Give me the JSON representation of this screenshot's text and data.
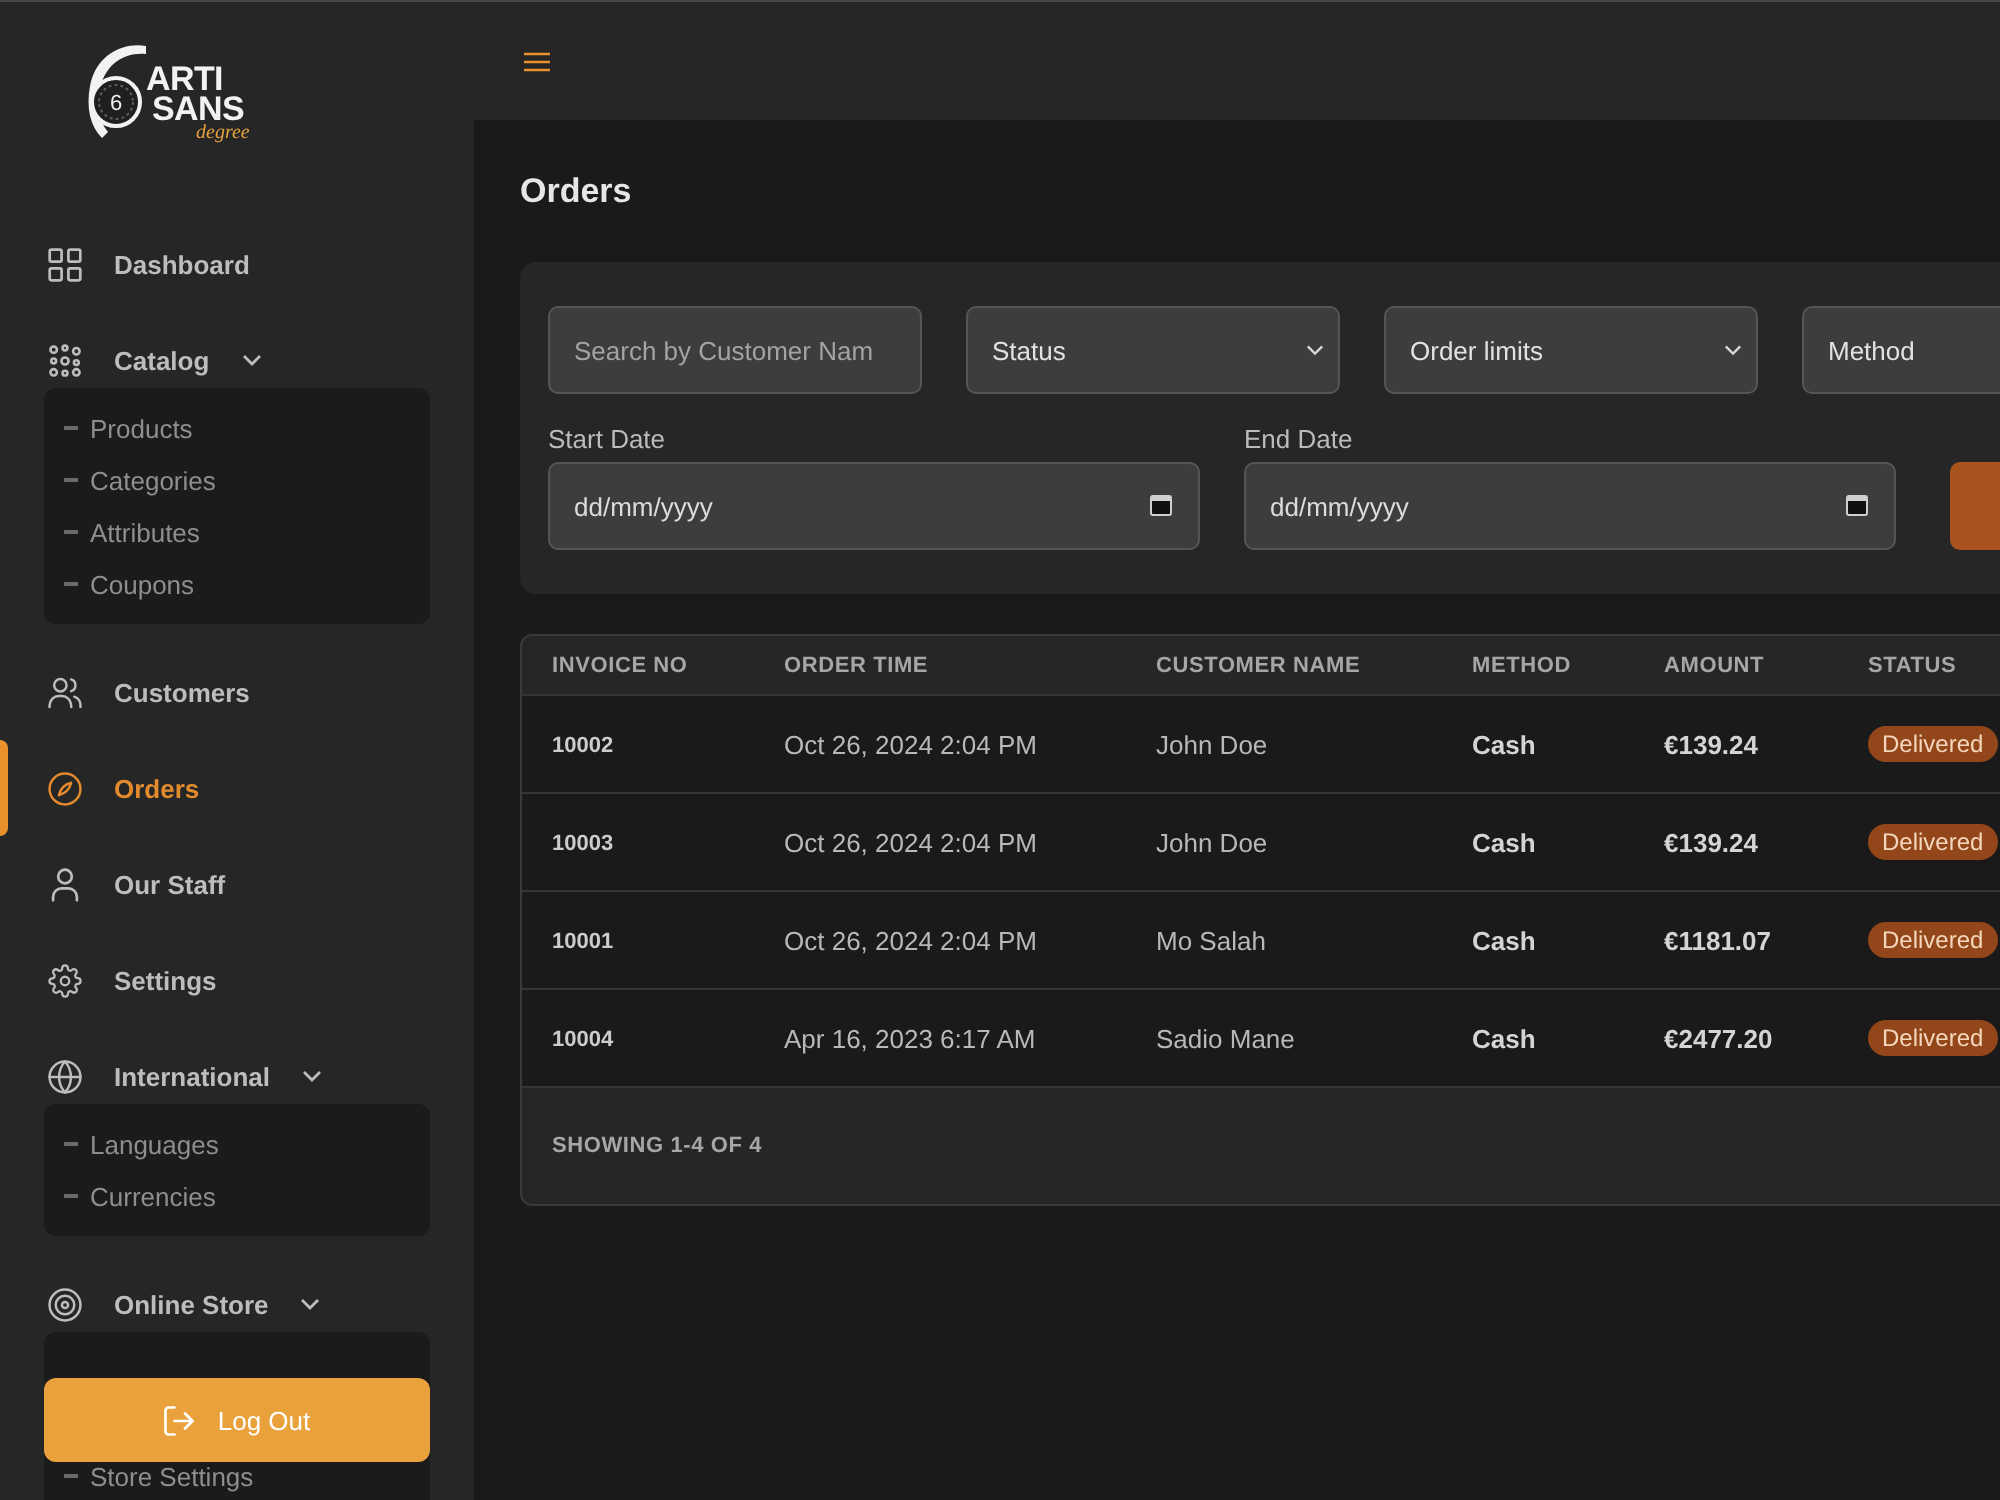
{
  "logo": {
    "mark": "6",
    "line_1": "ARTI",
    "line_2": "SANS",
    "tagline": "degree"
  },
  "sidebar": {
    "items": [
      {
        "kind": "link",
        "label": "Dashboard",
        "selected": false
      },
      {
        "kind": "group",
        "label": "Catalog",
        "selected": false,
        "expanded": true,
        "children": [
          {
            "label": "Products",
            "selected": false
          },
          {
            "label": "Categories",
            "selected": false
          },
          {
            "label": "Attributes",
            "selected": false
          },
          {
            "label": "Coupons",
            "selected": false
          }
        ]
      },
      {
        "kind": "link",
        "label": "Customers",
        "selected": false
      },
      {
        "kind": "link",
        "label": "Orders",
        "selected": true
      },
      {
        "kind": "link",
        "label": "Our Staff",
        "selected": false
      },
      {
        "kind": "link",
        "label": "Settings",
        "selected": false
      },
      {
        "kind": "group",
        "label": "International",
        "selected": false,
        "expanded": true,
        "children": [
          {
            "label": "Languages",
            "selected": false
          },
          {
            "label": "Currencies",
            "selected": false
          }
        ]
      },
      {
        "kind": "group",
        "label": "Online Store",
        "selected": false,
        "expanded": true,
        "children": [
          {
            "label": "Store Settings",
            "selected": false,
            "gap_before": true
          }
        ]
      }
    ],
    "logout_button": {
      "label": "Log Out"
    }
  },
  "page_title": "Orders",
  "filters": {
    "search": {
      "placeholder": "Search by Customer Nam"
    },
    "selects": [
      {
        "value": "Status"
      },
      {
        "value": "Order limits"
      },
      {
        "value": "Method"
      }
    ],
    "dates": [
      {
        "label": "Start Date",
        "placeholder": "dd/mm/yyyy"
      },
      {
        "label": "End Date",
        "placeholder": "dd/mm/yyyy"
      }
    ]
  },
  "table": {
    "columns": [
      "INVOICE NO",
      "ORDER TIME",
      "CUSTOMER NAME",
      "METHOD",
      "AMOUNT",
      "STATUS"
    ],
    "rows": [
      {
        "invoice_no": "10002",
        "order_time": "Oct 26, 2024 2:04 PM",
        "customer_name": "John Doe",
        "method": "Cash",
        "amount": "€139.24",
        "status": "Delivered"
      },
      {
        "invoice_no": "10003",
        "order_time": "Oct 26, 2024 2:04 PM",
        "customer_name": "John Doe",
        "method": "Cash",
        "amount": "€139.24",
        "status": "Delivered"
      },
      {
        "invoice_no": "10001",
        "order_time": "Oct 26, 2024 2:04 PM",
        "customer_name": "Mo Salah",
        "method": "Cash",
        "amount": "€1181.07",
        "status": "Delivered"
      },
      {
        "invoice_no": "10004",
        "order_time": "Apr 16, 2023 6:17 AM",
        "customer_name": "Sadio Mane",
        "method": "Cash",
        "amount": "€2477.20",
        "status": "Delivered"
      }
    ],
    "footer": "SHOWING 1-4 OF 4"
  }
}
